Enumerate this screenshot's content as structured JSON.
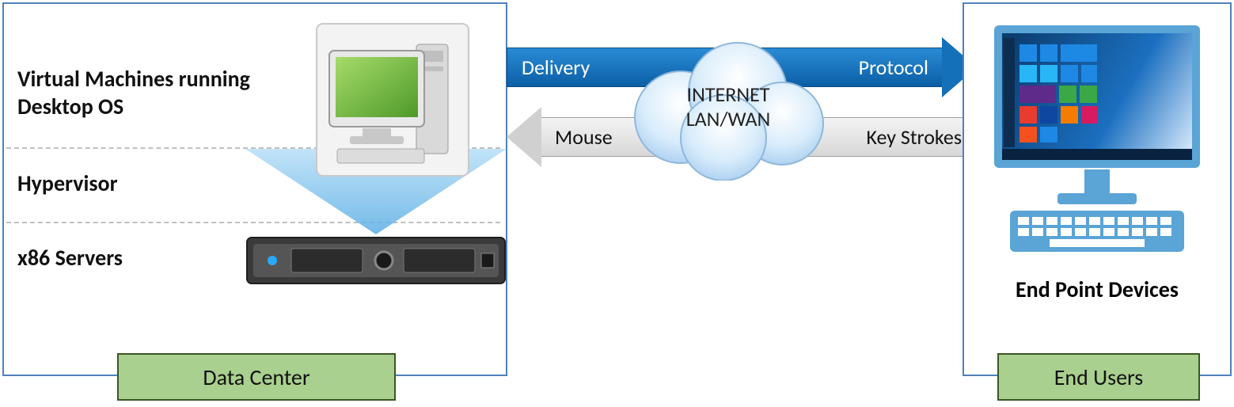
{
  "datacenter": {
    "title": "Data Center",
    "layers": {
      "vm": "Virtual Machines running Desktop OS",
      "hypervisor": "Hypervisor",
      "servers": "x86 Servers"
    }
  },
  "network": {
    "forward_left": "Delivery",
    "forward_right": "Protocol",
    "back_left": "Mouse",
    "back_right": "Key Strokes",
    "cloud_line1": "INTERNET",
    "cloud_line2": "LAN/WAN"
  },
  "endpoint": {
    "title": "End Users",
    "device_label": "End Point Devices"
  }
}
